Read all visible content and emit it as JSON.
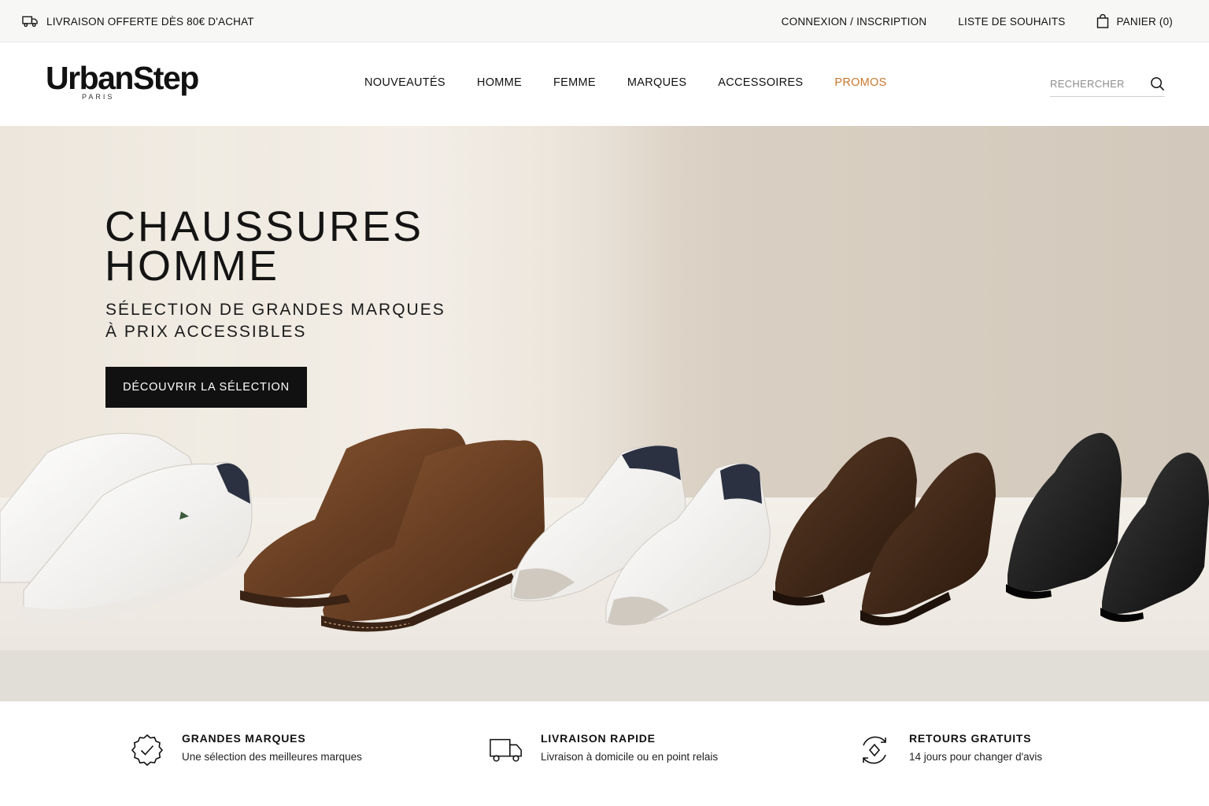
{
  "topbar": {
    "shipping_promo": "LIVRAISON OFFERTE DÈS 80€ D'ACHAT",
    "login": "CONNEXION / INSCRIPTION",
    "wishlist": "LISTE DE SOUHAITS",
    "cart": "PANIER (0)"
  },
  "header": {
    "logo": "UrbanStep",
    "logo_sub": "PARIS",
    "nav": [
      "NOUVEAUTÉS",
      "HOMME",
      "FEMME",
      "MARQUES",
      "ACCESSOIRES",
      "PROMOS"
    ],
    "search_placeholder": "RECHERCHER",
    "promo_color": "#c9782d"
  },
  "hero": {
    "title_line1": "CHAUSSURES",
    "title_line2": "HOMME",
    "subtitle_line1": "SÉLECTION DE GRANDES MARQUES",
    "subtitle_line2": "À PRIX ACCESSIBLES",
    "cta": "DÉCOUVRIR LA SÉLECTION"
  },
  "features": [
    {
      "icon": "badge-check-icon",
      "title": "GRANDES MARQUES",
      "desc": "Une sélection des meilleures marques"
    },
    {
      "icon": "truck-icon",
      "title": "LIVRAISON RAPIDE",
      "desc": "Livraison à domicile ou en point relais"
    },
    {
      "icon": "return-cycle-icon",
      "title": "RETOURS GRATUITS",
      "desc": "14 jours pour changer d'avis"
    }
  ]
}
